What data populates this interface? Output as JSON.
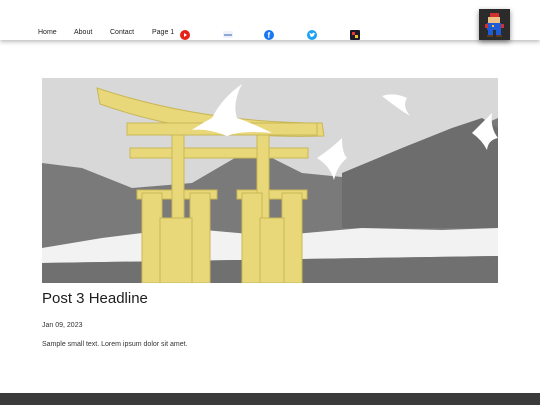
{
  "nav": {
    "home": "Home",
    "about": "About",
    "contact": "Contact",
    "page1": "Page 1"
  },
  "social": {
    "youtube_icon": "youtube-icon",
    "digitalocean_icon": "digitalocean-icon",
    "facebook_icon": "facebook-icon",
    "twitter_icon": "twitter-icon",
    "app_icon": "app-icon"
  },
  "post": {
    "headline": "Post 3 Headline",
    "date": "Jan 09, 2023",
    "excerpt": "Sample small text. Lorem ipsum dolor sit amet."
  },
  "colors": {
    "accent_youtube": "#e62117",
    "accent_facebook": "#1877f2",
    "accent_twitter": "#1da1f2",
    "hero_yellow": "#e8d87a",
    "footer": "#3a3a3a"
  }
}
